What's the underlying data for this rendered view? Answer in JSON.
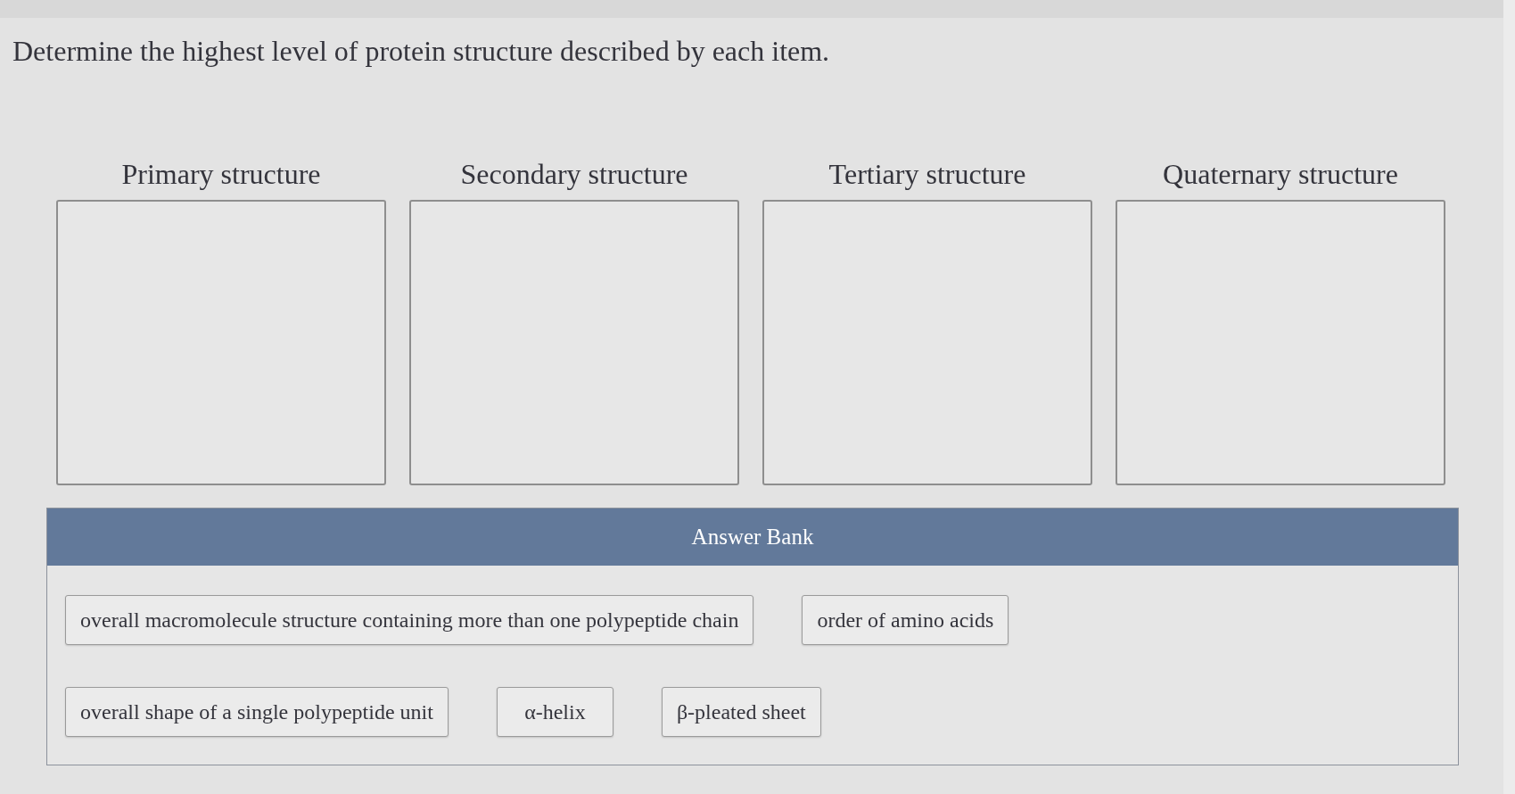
{
  "question": {
    "text": "Determine the highest level of protein structure described by each item."
  },
  "drop_zones": [
    {
      "label": "Primary structure"
    },
    {
      "label": "Secondary structure"
    },
    {
      "label": "Tertiary structure"
    },
    {
      "label": "Quaternary structure"
    }
  ],
  "answer_bank": {
    "title": "Answer Bank",
    "items": [
      {
        "text": "overall macromolecule structure containing more than one polypeptide chain"
      },
      {
        "text": "order of amino acids"
      },
      {
        "text": "overall shape of a single polypeptide unit"
      },
      {
        "text": "α-helix"
      },
      {
        "text": "β-pleated sheet"
      }
    ]
  }
}
